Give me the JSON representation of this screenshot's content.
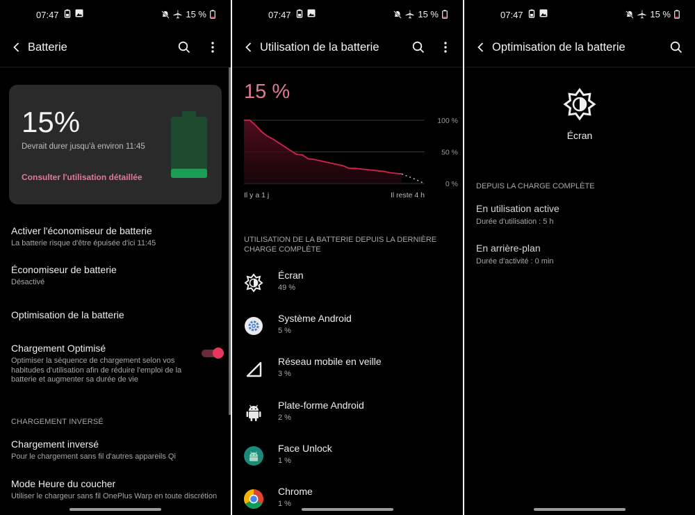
{
  "status": {
    "time": "07:47",
    "battery_pct": "15 %"
  },
  "screen1": {
    "title": "Batterie",
    "card": {
      "percent": "15%",
      "estimate": "Devrait durer jusqu'à environ 11:45",
      "link": "Consulter l'utilisation détaillée",
      "battery_fill_fraction": 0.15
    },
    "items": [
      {
        "title": "Activer l'économiseur de batterie",
        "subtitle": "La batterie risque d'être épuisée d'ici 11:45"
      },
      {
        "title": "Économiseur de batterie",
        "subtitle": "Désactivé"
      },
      {
        "title": "Optimisation de la batterie"
      },
      {
        "title": "Chargement Optimisé",
        "subtitle": "Optimiser la séquence de chargement selon vos habitudes d'utilisation afin de réduire l'emploi de la batterie et augmenter sa durée de vie",
        "toggle_on": true
      }
    ],
    "section": "CHARGEMENT INVERSÉ",
    "items2": [
      {
        "title": "Chargement inversé",
        "subtitle": "Pour le chargement sans fil d'autres appareils Qi"
      },
      {
        "title": "Mode Heure du coucher",
        "subtitle": "Utiliser le chargeur sans fil OnePlus Warp en toute discrétion"
      }
    ]
  },
  "screen2": {
    "title": "Utilisation de la batterie",
    "percent": "15 %",
    "chart_data": {
      "type": "line",
      "y_ticks": [
        "100 %",
        "50 %",
        "0 %"
      ],
      "x_start_label": "Il y a 1 j",
      "x_end_label": "Il reste 4 h",
      "ylim": [
        0,
        100
      ],
      "points": [
        100,
        100,
        92,
        82,
        75,
        70,
        64,
        58,
        52,
        46,
        45,
        39,
        38,
        36,
        34,
        32,
        30,
        28,
        24,
        24,
        23,
        22,
        21,
        20,
        19,
        17,
        16,
        15
      ],
      "projection": [
        15,
        8,
        0
      ],
      "line_color": "#d4234f"
    },
    "usage_header": "UTILISATION DE LA BATTERIE DEPUIS LA DERNIÈRE CHARGE COMPLÈTE",
    "apps": [
      {
        "name": "Écran",
        "pct": "49 %",
        "icon": "brightness-icon"
      },
      {
        "name": "Système Android",
        "pct": "5 %",
        "icon": "android-system-icon"
      },
      {
        "name": "Réseau mobile en veille",
        "pct": "3 %",
        "icon": "cell-signal-icon"
      },
      {
        "name": "Plate-forme Android",
        "pct": "2 %",
        "icon": "android-icon"
      },
      {
        "name": "Face Unlock",
        "pct": "1 %",
        "icon": "face-unlock-icon"
      },
      {
        "name": "Chrome",
        "pct": "1 %",
        "icon": "chrome-icon"
      }
    ]
  },
  "screen3": {
    "title": "Optimisation de la batterie",
    "hero": "Écran",
    "section": "DEPUIS LA CHARGE COMPLÈTE",
    "items": [
      {
        "title": "En utilisation active",
        "subtitle": "Durée d'utilisation : 5 h"
      },
      {
        "title": "En arrière-plan",
        "subtitle": "Durée d'activité : 0 min"
      }
    ]
  }
}
